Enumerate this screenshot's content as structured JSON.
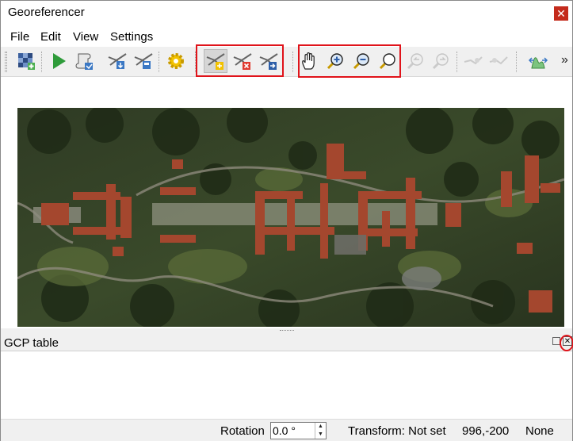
{
  "window": {
    "title": "Georeferencer",
    "close_glyph": "✕"
  },
  "menu": {
    "items": [
      "File",
      "Edit",
      "View",
      "Settings"
    ]
  },
  "toolbar": {
    "buttons": [
      {
        "icon": "open-raster-icon",
        "enabled": true
      },
      {
        "icon": "start-georeferencing-icon",
        "enabled": true
      },
      {
        "icon": "generate-gdal-script-icon",
        "enabled": true
      },
      {
        "icon": "load-gcp-points-icon",
        "enabled": true
      },
      {
        "icon": "save-gcp-points-icon",
        "enabled": true
      },
      {
        "icon": "transformation-settings-icon",
        "enabled": true
      },
      {
        "icon": "add-point-icon",
        "enabled": true,
        "active": true
      },
      {
        "icon": "delete-point-icon",
        "enabled": true
      },
      {
        "icon": "move-gcp-point-icon",
        "enabled": true
      },
      {
        "icon": "pan-icon",
        "enabled": true
      },
      {
        "icon": "zoom-in-icon",
        "enabled": true
      },
      {
        "icon": "zoom-out-icon",
        "enabled": true
      },
      {
        "icon": "zoom-to-layer-icon",
        "enabled": true
      },
      {
        "icon": "zoom-last-icon",
        "enabled": false
      },
      {
        "icon": "zoom-next-icon",
        "enabled": false
      },
      {
        "icon": "link-georeferencer-icon",
        "enabled": false
      },
      {
        "icon": "link-qgis-icon",
        "enabled": false
      },
      {
        "icon": "full-histogram-stretch-icon",
        "enabled": true
      }
    ],
    "overflow_glyph": "»",
    "highlight_color": "#e0131a"
  },
  "gcp_panel": {
    "title": "GCP table"
  },
  "status": {
    "rotation_label": "Rotation",
    "rotation_value": "0.0 °",
    "transform": "Transform: Not set",
    "coordinates": "996,-200",
    "crs": "None"
  },
  "colors": {
    "toolbar_bg": "#f0f0f0",
    "accent_red": "#e0131a",
    "close_red": "#c42b1c"
  }
}
